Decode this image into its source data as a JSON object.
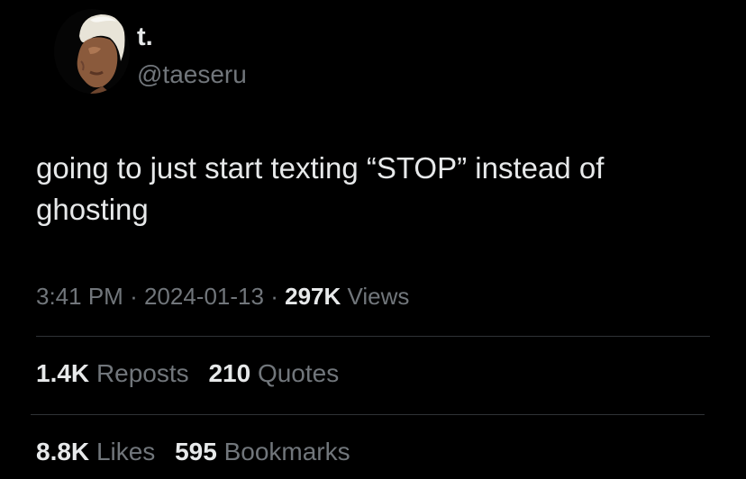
{
  "author": {
    "display_name": "t.",
    "handle": "@taeseru"
  },
  "tweet": {
    "text": "going to just start texting “STOP” instead of ghosting"
  },
  "meta": {
    "time": "3:41 PM",
    "separator1": "·",
    "date": "2024-01-13",
    "separator2": "·",
    "views_count": "297K",
    "views_label": "Views"
  },
  "engagement": {
    "reposts": {
      "count": "1.4K",
      "label": "Reposts"
    },
    "quotes": {
      "count": "210",
      "label": "Quotes"
    },
    "likes": {
      "count": "8.8K",
      "label": "Likes"
    },
    "bookmarks": {
      "count": "595",
      "label": "Bookmarks"
    }
  },
  "colors": {
    "background": "#000000",
    "primary_text": "#e7e9ea",
    "secondary_text": "#71767b",
    "divider": "#2f3336"
  }
}
